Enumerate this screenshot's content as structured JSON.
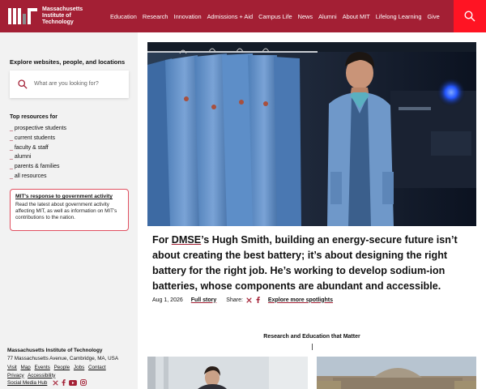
{
  "header": {
    "logo_lines": [
      "Massachusetts",
      "Institute of",
      "Technology"
    ],
    "nav": [
      "Education",
      "Research",
      "Innovation",
      "Admissions + Aid",
      "Campus Life",
      "News",
      "Alumni",
      "About MIT",
      "Lifelong Learning",
      "Give"
    ],
    "search_icon": "search-icon",
    "accent": "#a31f34",
    "search_bg": "#ff1423"
  },
  "sidebar": {
    "explore_heading": "Explore websites, people, and locations",
    "search_placeholder": "What are you looking for?",
    "top_resources_heading": "Top resources for",
    "resources": [
      "prospective students",
      "current students",
      "faculty & staff",
      "alumni",
      "parents & families",
      "all resources"
    ],
    "notice_title": "MIT's response to government activity",
    "notice_body": "Read the latest about government activity affecting MIT, as well as information on MIT's contributions to the nation.",
    "footer_title": "Massachusetts Institute of Technology",
    "footer_address": "77 Massachusetts Avenue, Cambridge, MA, USA",
    "footer_links_row1": [
      "Visit",
      "Map",
      "Events",
      "People",
      "Jobs",
      "Contact"
    ],
    "footer_links_row2": [
      "Privacy",
      "Accessibility"
    ],
    "footer_links_row3": [
      "Social Media Hub"
    ]
  },
  "main": {
    "headline_pre": "For ",
    "headline_link": "DMSE",
    "headline_post": "’s Hugh Smith, building an energy-secure future isn’t about creating the best battery; it’s about designing the right battery for the right job. He’s working to develop sodium-ion batteries, whose components are abundant and accessible.",
    "date": "Aug 1, 2026",
    "full_story": "Full story",
    "share_label": "Share:",
    "more_spotlights": "Explore more spotlights",
    "section_title": "Research and Education that Matter"
  }
}
